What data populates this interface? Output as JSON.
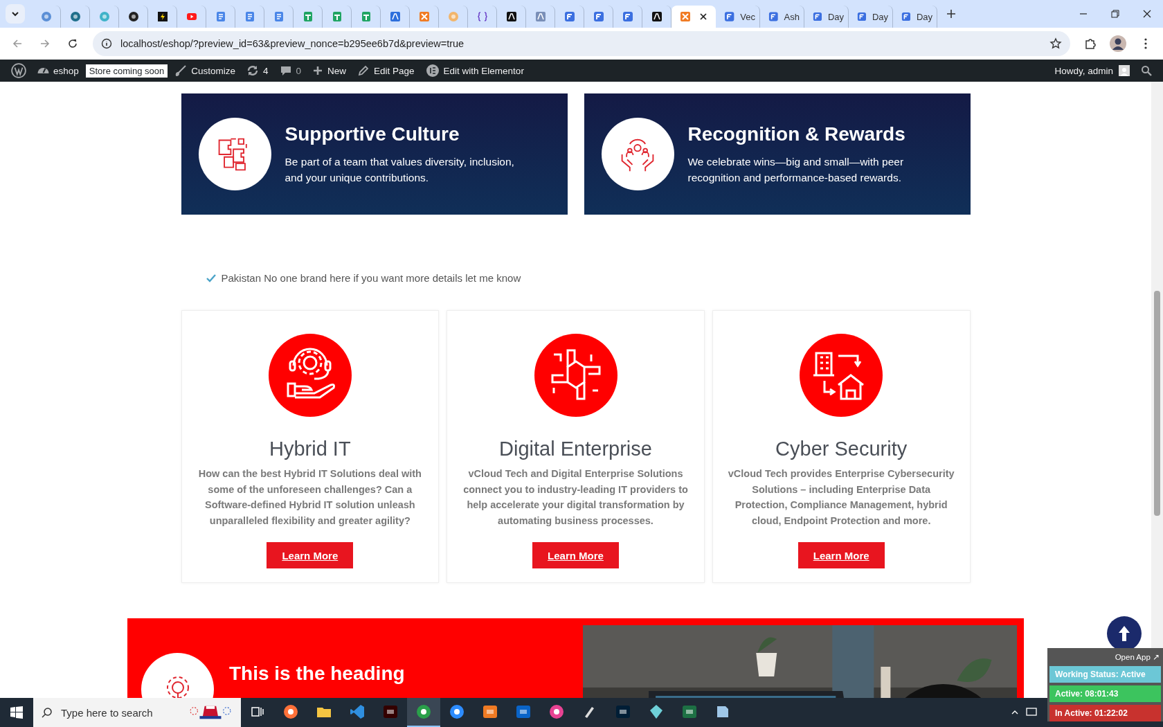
{
  "browser": {
    "tabs": [
      {
        "kind": "globe",
        "selected": false
      },
      {
        "kind": "ring",
        "selected": false
      },
      {
        "kind": "hex",
        "selected": false
      },
      {
        "kind": "knot",
        "selected": false
      },
      {
        "kind": "bolt",
        "selected": false
      },
      {
        "kind": "video",
        "selected": false
      },
      {
        "kind": "doc",
        "selected": false
      },
      {
        "kind": "doc",
        "selected": false
      },
      {
        "kind": "doc",
        "selected": false
      },
      {
        "kind": "sheet",
        "selected": false
      },
      {
        "kind": "sheet",
        "selected": false
      },
      {
        "kind": "sheet",
        "selected": false
      },
      {
        "kind": "chart",
        "selected": false
      },
      {
        "kind": "xampp",
        "selected": false
      },
      {
        "kind": "crown",
        "selected": false
      },
      {
        "kind": "braces",
        "selected": false
      },
      {
        "kind": "dark",
        "selected": false
      },
      {
        "kind": "grid",
        "selected": false
      },
      {
        "kind": "form",
        "selected": false
      },
      {
        "kind": "form",
        "selected": false
      },
      {
        "kind": "form",
        "selected": false
      },
      {
        "kind": "dark",
        "selected": false
      },
      {
        "kind": "xampp",
        "selected": true
      },
      {
        "kind": "form",
        "selected": false,
        "label": "Vec"
      },
      {
        "kind": "form",
        "selected": false,
        "label": "Ash"
      },
      {
        "kind": "form",
        "selected": false,
        "label": "Day"
      },
      {
        "kind": "form",
        "selected": false,
        "label": "Day"
      },
      {
        "kind": "form",
        "selected": false,
        "label": "Day"
      }
    ],
    "url": "localhost/eshop/?preview_id=63&preview_nonce=b295ee6b7d&preview=true"
  },
  "admin_bar": {
    "items": [
      {
        "kind": "wp"
      },
      {
        "kind": "site",
        "label": "eshop"
      },
      {
        "kind": "badge",
        "label": "Store coming soon"
      },
      {
        "kind": "customize",
        "label": "Customize"
      },
      {
        "kind": "updates",
        "label": "4"
      },
      {
        "kind": "comments",
        "label": "0"
      },
      {
        "kind": "new",
        "label": "New"
      },
      {
        "kind": "edit",
        "label": "Edit Page"
      },
      {
        "kind": "elementor",
        "label": "Edit with Elementor"
      }
    ],
    "greeting": "Howdy, admin"
  },
  "features": [
    {
      "kind": "puzzle",
      "title": "Supportive Culture",
      "text": "Be part of a team that values diversity, inclusion, and your unique contributions."
    },
    {
      "kind": "hands",
      "title": "Recognition & Rewards",
      "text": "We celebrate wins—big and small—with peer recognition and performance-based rewards."
    }
  ],
  "check_note": "Pakistan No one brand here if you want more details let me know",
  "services": [
    {
      "kind": "support",
      "title": "Hybrid IT",
      "text": "How can the best Hybrid IT Solutions deal with some of the unforeseen challenges? Can a Software-defined Hybrid IT solution unleash unparalleled flexibility and greater agility?",
      "button": "Learn More"
    },
    {
      "kind": "teamwork",
      "title": "Digital Enterprise",
      "text": "vCloud Tech and Digital Enterprise Solutions connect you to industry-leading IT providers to help accelerate your digital transformation by automating business processes.",
      "button": "Learn More"
    },
    {
      "kind": "relocate",
      "title": "Cyber Security",
      "text": "vCloud Tech provides Enterprise Cybersecurity Solutions – including Enterprise Data Protection, Compliance Management, hybrid cloud, Endpoint Protection and more.",
      "button": "Learn More"
    }
  ],
  "promo": {
    "heading": "This is the heading"
  },
  "tracker": {
    "open_app": "Open App ↗",
    "status": "Working Status: Active",
    "active": "Active: 08:01:43",
    "inactive": "In Active: 01:22:02"
  },
  "taskbar": {
    "search_placeholder": "Type here to search",
    "apps": [
      {
        "kind": "taskview",
        "selected": false
      },
      {
        "kind": "fox",
        "selected": false
      },
      {
        "kind": "folder",
        "selected": false
      },
      {
        "kind": "code",
        "selected": false
      },
      {
        "kind": "ai",
        "selected": false
      },
      {
        "kind": "chrome",
        "selected": true
      },
      {
        "kind": "zoom",
        "selected": false
      },
      {
        "kind": "xampp",
        "selected": false
      },
      {
        "kind": "mail",
        "selected": false
      },
      {
        "kind": "cloud",
        "selected": false
      },
      {
        "kind": "pen",
        "selected": false
      },
      {
        "kind": "ps",
        "selected": false
      },
      {
        "kind": "gem",
        "selected": false
      },
      {
        "kind": "excel",
        "selected": false
      },
      {
        "kind": "note",
        "selected": false
      }
    ]
  }
}
